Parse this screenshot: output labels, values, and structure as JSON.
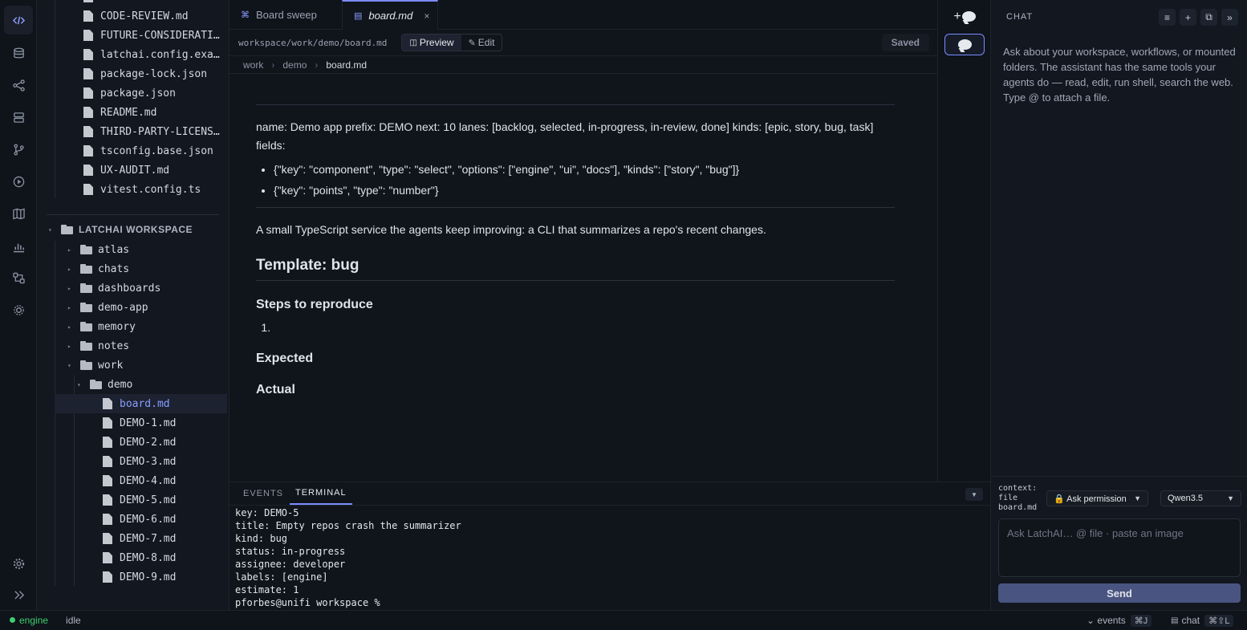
{
  "activity_bar": {
    "icons": [
      "code-icon",
      "database-icon",
      "share-icon",
      "layers-icon",
      "git-branch-icon",
      "play-icon",
      "map-icon",
      "chart-icon",
      "workflow-icon",
      "chip-icon"
    ],
    "bottom_icons": [
      "settings-icon",
      "expand-icon"
    ]
  },
  "explorer": {
    "top_files": [
      "CODE-REVIEW.md",
      "FUTURE-CONSIDERATIONS.md",
      "latchai.config.example.json",
      "package-lock.json",
      "package.json",
      "README.md",
      "THIRD-PARTY-LICENSES.md",
      "tsconfig.base.json",
      "UX-AUDIT.md",
      "vitest.config.ts"
    ],
    "workspace_label": "LATCHAI WORKSPACE",
    "folders": [
      "atlas",
      "chats",
      "dashboards",
      "demo-app",
      "memory",
      "notes"
    ],
    "work_folder": "work",
    "demo_folder": "demo",
    "demo_files": [
      "board.md",
      "DEMO-1.md",
      "DEMO-2.md",
      "DEMO-3.md",
      "DEMO-4.md",
      "DEMO-5.md",
      "DEMO-6.md",
      "DEMO-7.md",
      "DEMO-8.md",
      "DEMO-9.md"
    ],
    "selected_file": "board.md"
  },
  "tabs": [
    {
      "label": "Board sweep",
      "icon": "command-icon"
    },
    {
      "label": "board.md",
      "icon": "file-icon",
      "close": "×"
    }
  ],
  "pathbar": {
    "path": "workspace/work/demo/board.md",
    "preview_label": "Preview",
    "preview_icon": "◫",
    "edit_label": "Edit",
    "edit_icon": "✎",
    "saved_label": "Saved"
  },
  "breadcrumbs": [
    "work",
    "demo",
    "board.md"
  ],
  "document": {
    "frontmatter": "name: Demo app prefix: DEMO next: 10 lanes: [backlog, selected, in-progress, in-review, done] kinds: [epic, story, bug, task] fields:",
    "fields": [
      "{\"key\": \"component\", \"type\": \"select\", \"options\": [\"engine\", \"ui\", \"docs\"], \"kinds\": [\"story\", \"bug\"]}",
      "{\"key\": \"points\", \"type\": \"number\"}"
    ],
    "description": "A small TypeScript service the agents keep improving: a CLI that summarizes a repo's recent changes.",
    "template_heading": "Template: bug",
    "steps_heading": "Steps to reproduce",
    "expected_heading": "Expected",
    "actual_heading": "Actual"
  },
  "bottom_panel": {
    "tabs": [
      "EVENTS",
      "TERMINAL"
    ],
    "active_tab": "TERMINAL",
    "collapse_icon": "▼",
    "terminal_lines": [
      "key: DEMO-5",
      "title: Empty repos crash the summarizer",
      "kind: bug",
      "status: in-progress",
      "assignee: developer",
      "labels: [engine]",
      "estimate: 1",
      "pforbes@unifi workspace %"
    ]
  },
  "strip": {
    "new_chat_plus": "+",
    "new_chat_icon": "new-chat-icon",
    "chat_icon": "chat-bubble-icon"
  },
  "chat": {
    "title": "CHAT",
    "header_buttons": [
      "≡",
      "+",
      "⧉",
      "»"
    ],
    "hint": "Ask about your workspace, workflows, or mounted folders. The assistant has the same tools your agents do — read, edit, run shell, search the web. Type @ to attach a file.",
    "context_lines": [
      "context:",
      "file",
      "board.md"
    ],
    "permission_label": "🔒 Ask permission",
    "model_label": "Qwen3.5",
    "input_placeholder": "Ask LatchAI…  @ file · paste an image",
    "send_label": "Send"
  },
  "status_bar": {
    "engine_label": "engine",
    "state_label": "idle",
    "events_label": "⌄ events",
    "events_shortcut": "⌘J",
    "chat_label": "chat",
    "chat_shortcut": "⌘⇧L"
  },
  "colors": {
    "accent": "#7b8cff",
    "engine_ok": "#3ecf6e",
    "background": "#0f131a"
  }
}
